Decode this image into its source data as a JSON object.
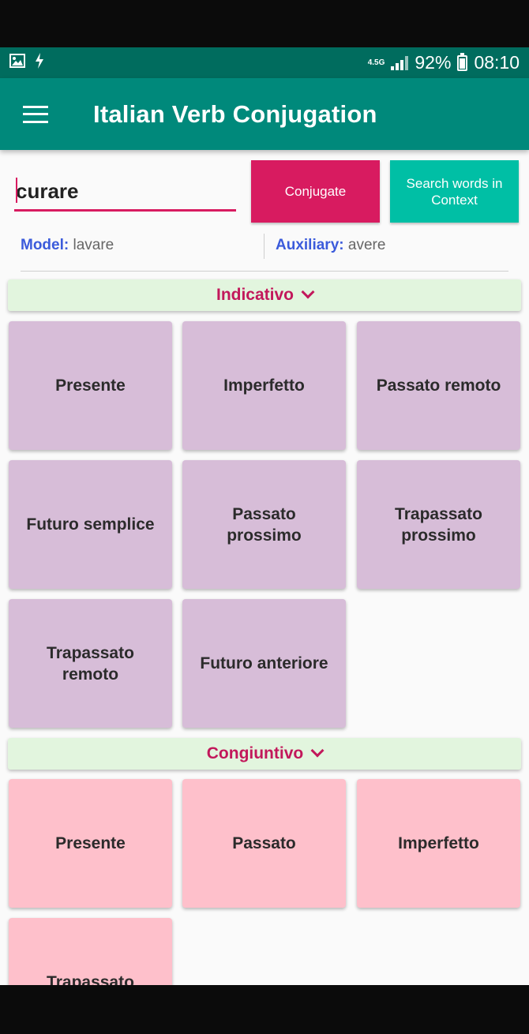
{
  "status_bar": {
    "network": "4.5G",
    "battery": "92%",
    "time": "08:10",
    "icons": [
      "image-icon",
      "flash-icon",
      "signal-icon",
      "battery-icon"
    ]
  },
  "app_bar": {
    "title": "Italian Verb Conjugation",
    "menu_icon": "hamburger-menu-icon",
    "color": "#00897b"
  },
  "search": {
    "value": "curare",
    "conjugate_label": "Conjugate",
    "context_label": "Search words in Context"
  },
  "info": {
    "model_label": "Model:",
    "model_value": "lavare",
    "auxiliary_label": "Auxiliary:",
    "auxiliary_value": "avere"
  },
  "sections": [
    {
      "title": "Indicativo",
      "tiles": [
        "Presente",
        "Imperfetto",
        "Passato remoto",
        "Futuro semplice",
        "Passato prossimo",
        "Trapassato prossimo",
        "Trapassato remoto",
        "Futuro anteriore"
      ]
    },
    {
      "title": "Congiuntivo",
      "tiles": [
        "Presente",
        "Passato",
        "Imperfetto",
        "Trapassato"
      ]
    }
  ],
  "colors": {
    "accent": "#d81b60",
    "teal_button": "#00bfa5",
    "indicativo_tile": "#d7bdd8",
    "congiuntivo_tile": "#fec0cb",
    "section_header_bg": "#e2f5de"
  }
}
